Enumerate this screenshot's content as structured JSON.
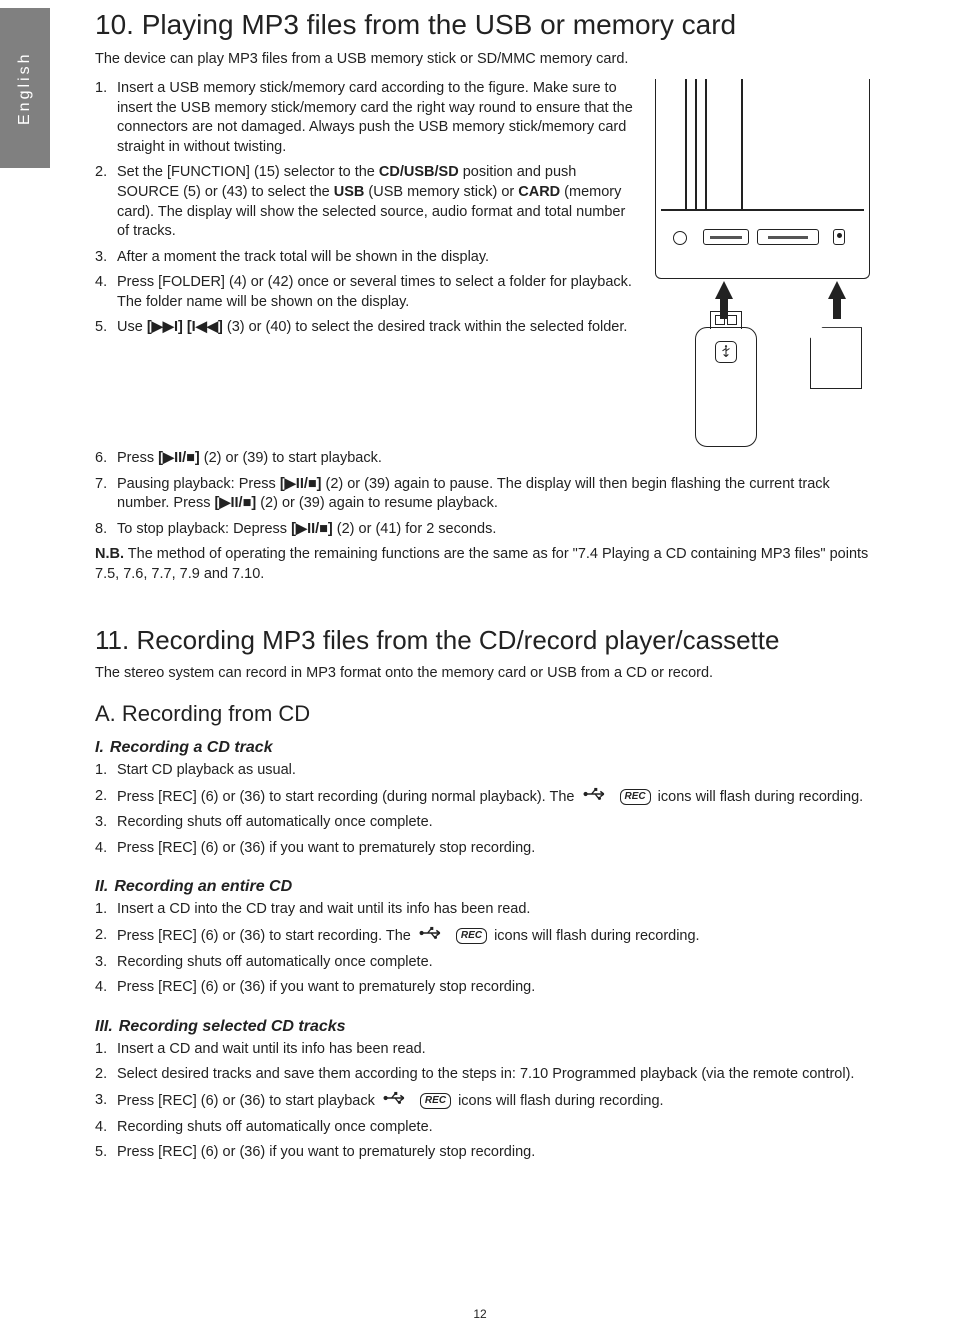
{
  "lang_tab": "English",
  "page_number": "12",
  "sec10": {
    "title": "10. Playing MP3 files from the USB or memory card",
    "intro": "The device can play MP3 files from a USB memory stick or SD/MMC memory card.",
    "items": [
      {
        "num": "1.",
        "text": "Insert a USB memory stick/memory card according to the figure. Make sure to insert the USB memory stick/memory card the right way round to ensure that the connectors are not damaged. Always push the USB memory stick/memory card straight in without twisting."
      },
      {
        "num": "2.",
        "text_a": "Set the [FUNCTION] (15) selector to the ",
        "b1": "CD/USB/SD",
        "text_b": " position and push SOURCE (5) or (43) to select the ",
        "b2": "USB",
        "text_c": " (USB memory stick) or ",
        "b3": "CARD",
        "text_d": " (memory card). The display will show the selected source, audio format and total number of tracks."
      },
      {
        "num": "3.",
        "text": "After a moment the track total will be shown in the display."
      },
      {
        "num": "4.",
        "text": "Press [FOLDER] (4) or (42) once or several times to select a folder for playback. The folder name will be shown on the display."
      },
      {
        "num": "5.",
        "text_a": "Use ",
        "b1": "[▶▶I] [I◀◀]",
        "text_b": " (3) or (40) to select the desired track within the selected folder."
      }
    ],
    "items_wide": [
      {
        "num": "6.",
        "text_a": "Press ",
        "b1": "[▶II/■]",
        "text_b": " (2) or (39) to start playback."
      },
      {
        "num": "7.",
        "text_a": "Pausing playback: Press ",
        "b1": "[▶II/■]",
        "text_b": " (2) or (39) again to pause. The display will then begin flashing the current track number. Press ",
        "b2": "[▶II/■]",
        "text_c": " (2) or (39) again to resume playback."
      },
      {
        "num": "8.",
        "text_a": "To stop playback: Depress ",
        "b1": "[▶II/■]",
        "text_b": " (2) or (41) for 2 seconds."
      }
    ],
    "nb_label": "N.B.",
    "nb_text": " The method of operating the remaining functions are the same as for \"7.4 Playing a CD containing MP3 files\" points 7.5, 7.6, 7.7, 7.9 and 7.10."
  },
  "sec11": {
    "title": "11. Recording MP3 files from the CD/record player/cassette",
    "intro": "The stereo system can record in MP3 format onto the memory card or USB from a CD or record.",
    "a_title": "A. Recording from CD",
    "i": {
      "num": "I.",
      "title": "Recording a CD track",
      "items": [
        {
          "num": "1.",
          "text": "Start CD playback as usual."
        },
        {
          "num": "2.",
          "text_a": "Press [REC] (6) or (36) to start recording (during normal playback). The ",
          "rec": "REC",
          "text_b": " icons will flash during recording."
        },
        {
          "num": "3.",
          "text": "Recording shuts off automatically once complete."
        },
        {
          "num": "4.",
          "text": "Press [REC] (6) or (36) if you want to prematurely stop recording."
        }
      ]
    },
    "ii": {
      "num": "II.",
      "title": "Recording an entire CD",
      "items": [
        {
          "num": "1.",
          "text": "Insert a CD into the CD tray and wait until its info has been read."
        },
        {
          "num": "2.",
          "text_a": "Press [REC] (6) or (36) to start recording. The ",
          "rec": "REC",
          "text_b": " icons will flash during recording."
        },
        {
          "num": "3.",
          "text": "Recording shuts off automatically once complete."
        },
        {
          "num": "4.",
          "text": "Press [REC] (6) or (36) if you want to prematurely stop recording."
        }
      ]
    },
    "iii": {
      "num": "III.",
      "title": "Recording selected CD tracks",
      "items": [
        {
          "num": "1.",
          "text": "Insert a CD and wait until its info has been read."
        },
        {
          "num": "2.",
          "text": "Select desired tracks and save them according to the steps in: 7.10 Programmed playback (via the remote control)."
        },
        {
          "num": "3.",
          "text_a": "Press [REC] (6) or (36) to start playback ",
          "rec": "REC",
          "text_b": " icons will flash during recording."
        },
        {
          "num": "4.",
          "text": "Recording shuts off automatically once complete."
        },
        {
          "num": "5.",
          "text": "Press [REC] (6) or (36) if you want to prematurely stop recording."
        }
      ]
    }
  }
}
